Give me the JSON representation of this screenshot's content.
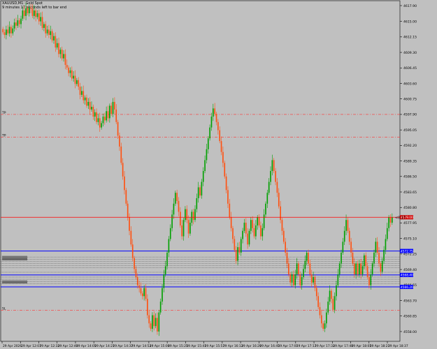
{
  "header": {
    "symbol_line": "XAUUSD,M1: Gold Spot",
    "timer_line": "9 minutes 17 seconds left to bar end"
  },
  "colors": {
    "background": "#c0c0c0",
    "bull": "#00a000",
    "bear": "#ff5010",
    "price_line": "#ff0000",
    "level_line": "#0000ff",
    "tp_line": "#ff3030"
  },
  "chart_data": {
    "type": "candlestick",
    "symbol": "XAUUSD",
    "timeframe": "M1",
    "ylim": [
      4556.2,
      4618.8
    ],
    "price_ticks": [
      "4617.90",
      "4615.00",
      "4612.15",
      "4609.30",
      "4606.45",
      "4603.60",
      "4600.75",
      "4597.90",
      "4595.05",
      "4592.20",
      "4589.35",
      "4586.50",
      "4583.65",
      "4580.80",
      "4577.95",
      "4575.10",
      "4572.25",
      "4569.40",
      "4566.55",
      "4563.70",
      "4560.85",
      "4558.00"
    ],
    "time_ticks": [
      "29 Apr 2026",
      "29 Apr 12:07",
      "29 Apr 12:33",
      "29 Apr 12:49",
      "29 Apr 14:05",
      "29 Apr 14:21",
      "29 Apr 14:37",
      "29 Apr 14:53",
      "29 Apr 15:09",
      "29 Apr 15:25",
      "29 Apr 15:41",
      "29 Apr 15:57",
      "29 Apr 16:13",
      "29 Apr 16:29",
      "29 Apr 16:45",
      "29 Apr 17:01",
      "29 Apr 17:17",
      "29 Apr 17:33",
      "29 Apr 17:49",
      "29 Apr 18:05",
      "29 Apr 18:21",
      "29 Apr 18:37"
    ],
    "price_label": "4579.00",
    "countdown": "<0:17",
    "labels": {
      "tp1": "TP",
      "tp2": "TP",
      "sl": "SL"
    },
    "blue_levels": [
      {
        "price": 4572.8,
        "label": "4572.75"
      },
      {
        "price": 4568.4,
        "label": "4568.40"
      },
      {
        "price": 4566.2,
        "label": "4566.20"
      }
    ],
    "dashed_levels": [
      4597.9,
      4593.7,
      4561.9
    ],
    "dotted_levels": [
      4571.7,
      4571.3,
      4570.9,
      4570.5,
      4570.1,
      4569.7,
      4568.9,
      4568.0,
      4567.6,
      4567.2,
      4566.8
    ],
    "closes": [
      4613.0,
      4612.5,
      4613.5,
      4612.8,
      4614.0,
      4612.8,
      4613.7,
      4614.8,
      4614.2,
      4615.2,
      4614.5,
      4615.5,
      4617.0,
      4616.0,
      4617.4,
      4616.5,
      4617.5,
      4617.3,
      4616.0,
      4617.0,
      4615.8,
      4616.5,
      4615.0,
      4615.8,
      4613.8,
      4614.5,
      4612.8,
      4613.5,
      4612.5,
      4613.2,
      4611.5,
      4612.3,
      4610.2,
      4611.0,
      4609.0,
      4609.8,
      4608.2,
      4609.0,
      4607.0,
      4606.5,
      4605.5,
      4606.0,
      4604.5,
      4605.0,
      4603.5,
      4604.2,
      4603.0,
      4601.5,
      4602.2,
      4600.5,
      4601.0,
      4599.5,
      4600.2,
      4598.8,
      4599.3,
      4597.5,
      4598.3,
      4596.5,
      4597.2,
      4595.5,
      4596.3,
      4597.5,
      4596.8,
      4598.5,
      4597.2,
      4599.5,
      4598.0,
      4600.2,
      4598.8,
      4596.5,
      4594.0,
      4592.0,
      4589.0,
      4586.5,
      4584.0,
      4581.5,
      4579.0,
      4576.5,
      4574.0,
      4571.5,
      4569.5,
      4568.0,
      4566.5,
      4566.0,
      4565.0,
      4564.5,
      4566.0,
      4564.0,
      4561.0,
      4559.5,
      4558.5,
      4561.0,
      4559.0,
      4560.5,
      4558.0,
      4561.5,
      4563.5,
      4566.0,
      4568.5,
      4570.0,
      4572.5,
      4575.0,
      4577.0,
      4579.5,
      4581.5,
      4583.5,
      4582.0,
      4580.0,
      4577.5,
      4575.5,
      4578.5,
      4580.5,
      4578.5,
      4576.0,
      4578.0,
      4580.0,
      4578.5,
      4580.5,
      4582.5,
      4584.5,
      4583.0,
      4585.5,
      4587.5,
      4589.5,
      4591.5,
      4593.5,
      4595.5,
      4597.5,
      4599.0,
      4598.0,
      4596.5,
      4595.0,
      4593.0,
      4591.0,
      4589.0,
      4586.5,
      4584.0,
      4581.5,
      4579.0,
      4577.0,
      4575.0,
      4573.0,
      4571.0,
      4573.5,
      4572.5,
      4575.0,
      4576.5,
      4578.0,
      4576.0,
      4574.0,
      4576.5,
      4578.5,
      4577.0,
      4575.5,
      4577.5,
      4579.0,
      4577.5,
      4575.5,
      4577.0,
      4579.5,
      4581.5,
      4583.5,
      4585.5,
      4587.5,
      4589.5,
      4587.5,
      4585.5,
      4583.5,
      4581.0,
      4578.5,
      4576.5,
      4574.5,
      4572.5,
      4570.5,
      4568.5,
      4567.0,
      4568.5,
      4566.5,
      4568.5,
      4570.5,
      4568.5,
      4566.5,
      4568.0,
      4569.5,
      4571.0,
      4572.5,
      4570.5,
      4568.5,
      4567.0,
      4568.0,
      4566.0,
      4564.5,
      4562.5,
      4561.0,
      4559.5,
      4558.5,
      4559.5,
      4561.5,
      4563.5,
      4565.5,
      4564.0,
      4562.0,
      4564.5,
      4566.5,
      4568.5,
      4570.5,
      4572.5,
      4574.5,
      4576.5,
      4578.5,
      4576.5,
      4574.5,
      4572.5,
      4570.5,
      4568.5,
      4570.5,
      4568.5,
      4570.5,
      4568.5,
      4570.0,
      4572.0,
      4570.0,
      4568.0,
      4566.5,
      4568.5,
      4570.5,
      4572.5,
      4574.5,
      4572.5,
      4570.5,
      4569.0,
      4571.0,
      4573.0,
      4575.0,
      4577.0,
      4579.0,
      4578.0,
      4579.0
    ]
  }
}
